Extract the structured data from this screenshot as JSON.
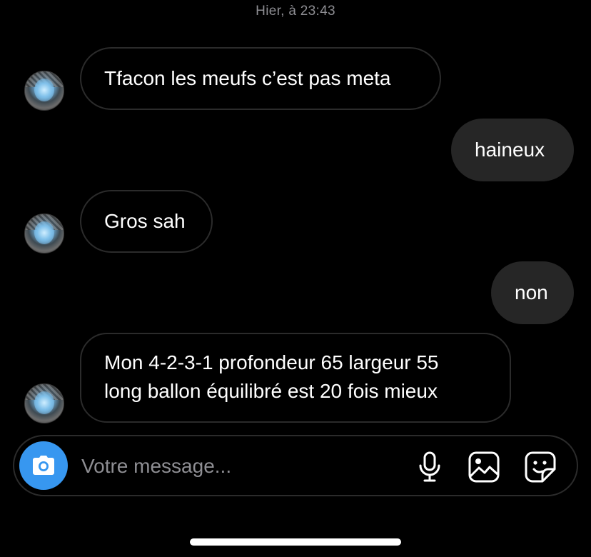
{
  "thread": {
    "timestamp": "Hier, à 23:43",
    "messages": [
      {
        "from": "them",
        "lines": [
          "Tfacon les meufs c’est pas meta"
        ]
      },
      {
        "from": "me",
        "lines": [
          "haineux"
        ]
      },
      {
        "from": "them",
        "lines": [
          "Gros sah"
        ]
      },
      {
        "from": "me",
        "lines": [
          "non"
        ]
      },
      {
        "from": "them",
        "lines": [
          "Mon 4-2-3-1 profondeur 65 largeur 55",
          "long ballon équilibré est 20 fois mieux"
        ]
      }
    ]
  },
  "composer": {
    "placeholder": "Votre message...",
    "camera_icon": "camera-icon",
    "mic_icon": "microphone-icon",
    "gallery_icon": "gallery-icon",
    "sticker_icon": "sticker-icon"
  },
  "colors": {
    "background": "#000000",
    "outgoing_bubble": "#262626",
    "incoming_border": "#2b2b2b",
    "camera_button": "#3797f0",
    "timestamp_text": "#8e8e93"
  }
}
